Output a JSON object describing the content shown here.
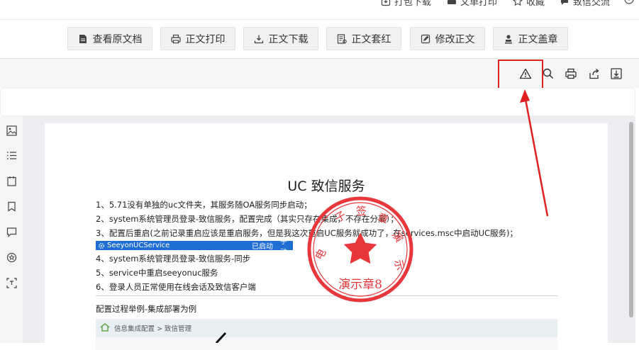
{
  "top_toolbar": {
    "items": [
      {
        "label": "打包下载",
        "icon": "download-icon"
      },
      {
        "label": "文单打印",
        "icon": "printer-icon"
      },
      {
        "label": "收藏",
        "icon": "star-icon"
      },
      {
        "label": "致信交流",
        "icon": "chat-icon"
      }
    ]
  },
  "actions": [
    {
      "label": "查看原文档",
      "icon": "document-icon"
    },
    {
      "label": "正文打印",
      "icon": "printer-icon"
    },
    {
      "label": "正文下载",
      "icon": "download-icon"
    },
    {
      "label": "正文套红",
      "icon": "template-icon"
    },
    {
      "label": "修改正文",
      "icon": "edit-icon"
    },
    {
      "label": "正文盖章",
      "icon": "stamp-icon"
    }
  ],
  "viewer_toolbar": {
    "icons": [
      "warning-icon",
      "search-icon",
      "printer-icon",
      "share-icon",
      "download-icon"
    ],
    "highlight_color": "#e02020"
  },
  "sidebar": {
    "icons": [
      "thumbnail-icon",
      "outline-icon",
      "attachment-icon",
      "bookmark-icon",
      "comment-icon",
      "seal-icon",
      "ocr-icon"
    ]
  },
  "document": {
    "title": "UC 致信服务",
    "lines": [
      "1、5.71没有单独的uc文件夹，其服务随OA服务同步启动；",
      "2、system系统管理员登录-致信服务，配置完成（其实只存在集成，不存在分离）；",
      "3、配置后重启(之前记录重启应该是重启服务，但是我这次重启UC服务就成功了，在services.msc中启动UC服务)；",
      "4、system系统管理员登录-致信服务-同步",
      "5、service中重启seeyonuc服务",
      "6、登录人员正常使用在线会话及致信客户端"
    ],
    "service_row": {
      "name": "SeeyonUCService",
      "status": "已启动",
      "mode": "手动"
    },
    "sub_heading": "配置过程举例-集成部署为例",
    "breadcrumb": "信息集成配置 > 致信管理",
    "stamp": {
      "top_text": "电子签章演示",
      "bottom_text": "演示章8",
      "color": "#e8373b"
    }
  },
  "colors": {
    "accent_red": "#e02020",
    "selection_blue": "#1e6ed4"
  }
}
